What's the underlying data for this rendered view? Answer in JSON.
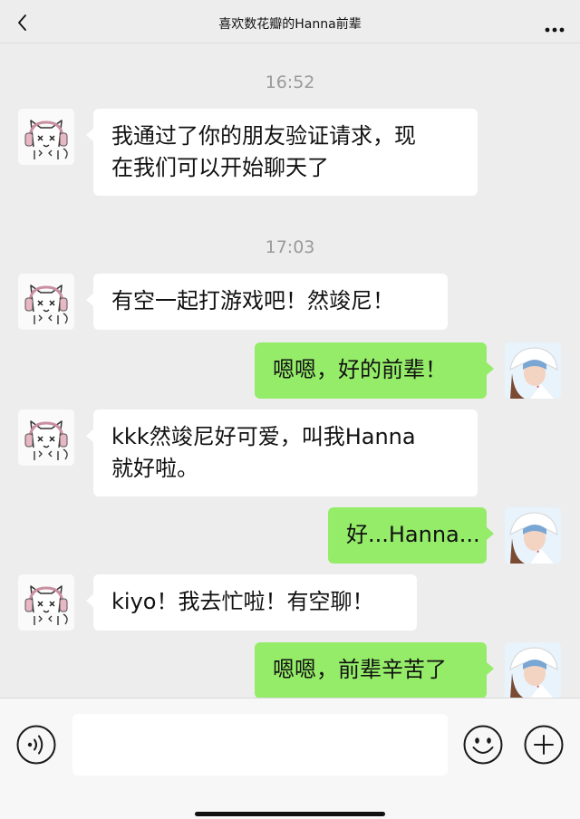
{
  "header": {
    "back_icon": "chevron-left-icon",
    "title": "喜欢数花瓣的Hanna前辈",
    "more_icon": "more-dots-icon"
  },
  "messages": [
    {
      "type": "time",
      "text": "16:52"
    },
    {
      "type": "in",
      "avatar": "cat-headphones-avatar",
      "lines": [
        "我通过了你的朋友验证请求，现",
        "在我们可以开始聊天了"
      ]
    },
    {
      "type": "time",
      "text": "17:03"
    },
    {
      "type": "in",
      "avatar": "cat-headphones-avatar",
      "lines": [
        "有空一起打游戏吧！然竣尼！"
      ]
    },
    {
      "type": "out",
      "avatar": "girl-photo-avatar",
      "lines": [
        "嗯嗯，好的前辈！"
      ]
    },
    {
      "type": "in",
      "avatar": "cat-headphones-avatar",
      "lines": [
        "kkk然竣尼好可爱，叫我Hanna",
        "就好啦。"
      ]
    },
    {
      "type": "out",
      "avatar": "girl-photo-avatar",
      "lines": [
        "好...Hanna..."
      ]
    },
    {
      "type": "in",
      "avatar": "cat-headphones-avatar",
      "lines": [
        "kiyo！我去忙啦！有空聊！"
      ]
    },
    {
      "type": "out",
      "avatar": "girl-photo-avatar",
      "lines": [
        "嗯嗯，前辈辛苦了"
      ]
    }
  ],
  "input_bar": {
    "voice_icon": "voice-icon",
    "input_value": "",
    "emoji_icon": "emoji-icon",
    "plus_icon": "plus-icon"
  },
  "colors": {
    "background": "#ededed",
    "incoming_bubble": "#ffffff",
    "outgoing_bubble": "#95ec69",
    "timestamp": "#9a9a9a"
  }
}
